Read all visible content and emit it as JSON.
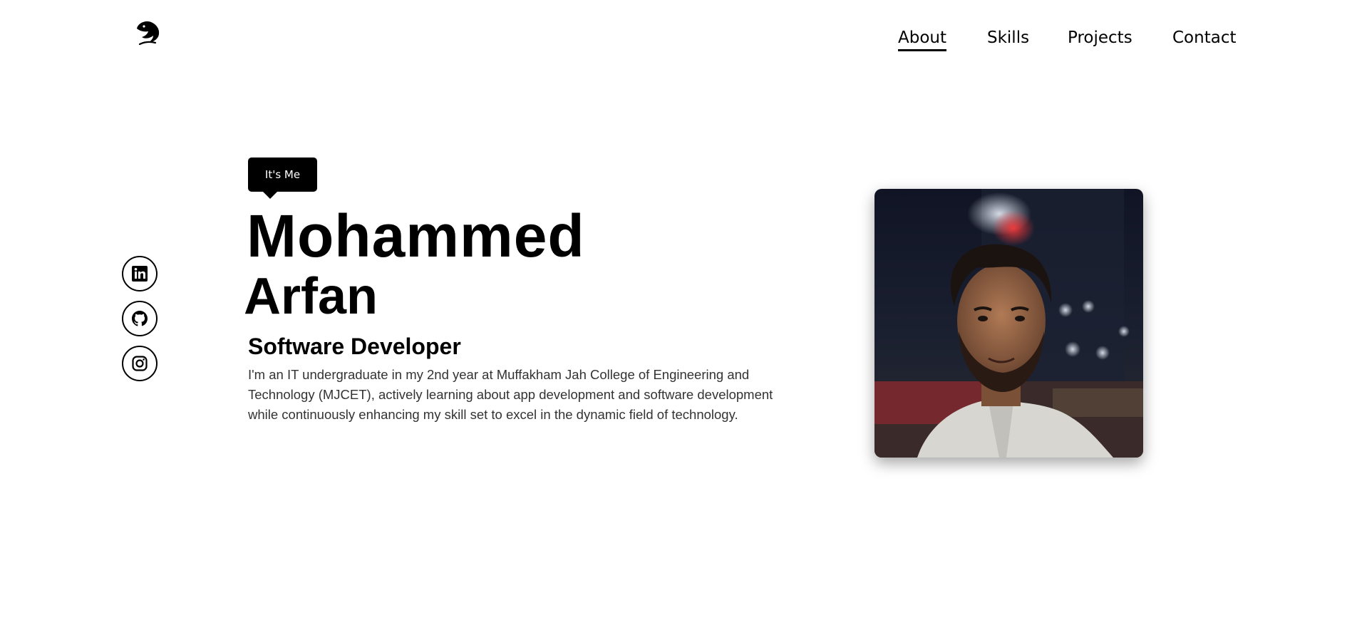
{
  "nav": {
    "logo_icon": "eagle-head-icon",
    "items": [
      {
        "label": "About",
        "active": true
      },
      {
        "label": "Skills",
        "active": false
      },
      {
        "label": "Projects",
        "active": false
      },
      {
        "label": "Contact",
        "active": false
      }
    ]
  },
  "socials": [
    {
      "icon": "linkedin-icon"
    },
    {
      "icon": "github-icon"
    },
    {
      "icon": "instagram-icon"
    }
  ],
  "hero": {
    "badge": "It's Me",
    "first_name": "Mohammed",
    "last_name": "Arfan",
    "role": "Software Developer",
    "bio": "I'm an IT undergraduate in my 2nd year at Muffakham Jah College of Engineering and Technology (MJCET), actively learning about app development and software development while continuously enhancing my skill set to excel in the dynamic field of technology."
  },
  "colors": {
    "primary": "#000000",
    "background": "#ffffff",
    "text_muted": "#333333"
  }
}
